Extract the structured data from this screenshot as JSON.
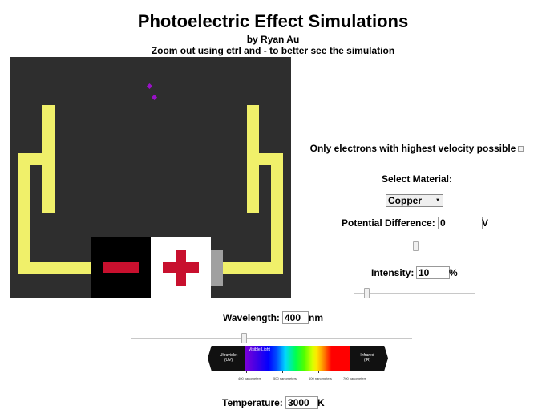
{
  "header": {
    "title": "Photoelectric Effect Simulations",
    "author": "by Ryan Au",
    "hint": "Zoom out using ctrl and - to better see the simulation"
  },
  "colors": {
    "sim_background": "#2e2e2e",
    "wire": "#f0f06a",
    "electron": "#9a10c8",
    "terminal_sign": "#c8102e"
  },
  "controls": {
    "velocity_option": {
      "label": "Only electrons with highest velocity possible",
      "checked": false
    },
    "material": {
      "label": "Select Material:",
      "value": "Copper"
    },
    "potential": {
      "label": "Potential Difference:",
      "value": "0",
      "unit": "V",
      "slider_position": 0.5
    },
    "intensity": {
      "label": "Intensity:",
      "value": "10",
      "unit": "%",
      "slider_position": 0.1
    },
    "wavelength": {
      "label": "Wavelength:",
      "value": "400",
      "unit": "nm",
      "slider_position": 0.4
    },
    "temperature": {
      "label": "Temperature:",
      "value": "3000",
      "unit": "K"
    }
  },
  "spectrum": {
    "uv_label_line1": "Ultraviolet",
    "uv_label_line2": "(UV)",
    "visible_label": "Visible Light",
    "ir_label_line1": "Infrared",
    "ir_label_line2": "(IR)",
    "ticks": [
      "400 nanometers",
      "500 nanometers",
      "600 nanometers",
      "700 nanometers"
    ]
  }
}
